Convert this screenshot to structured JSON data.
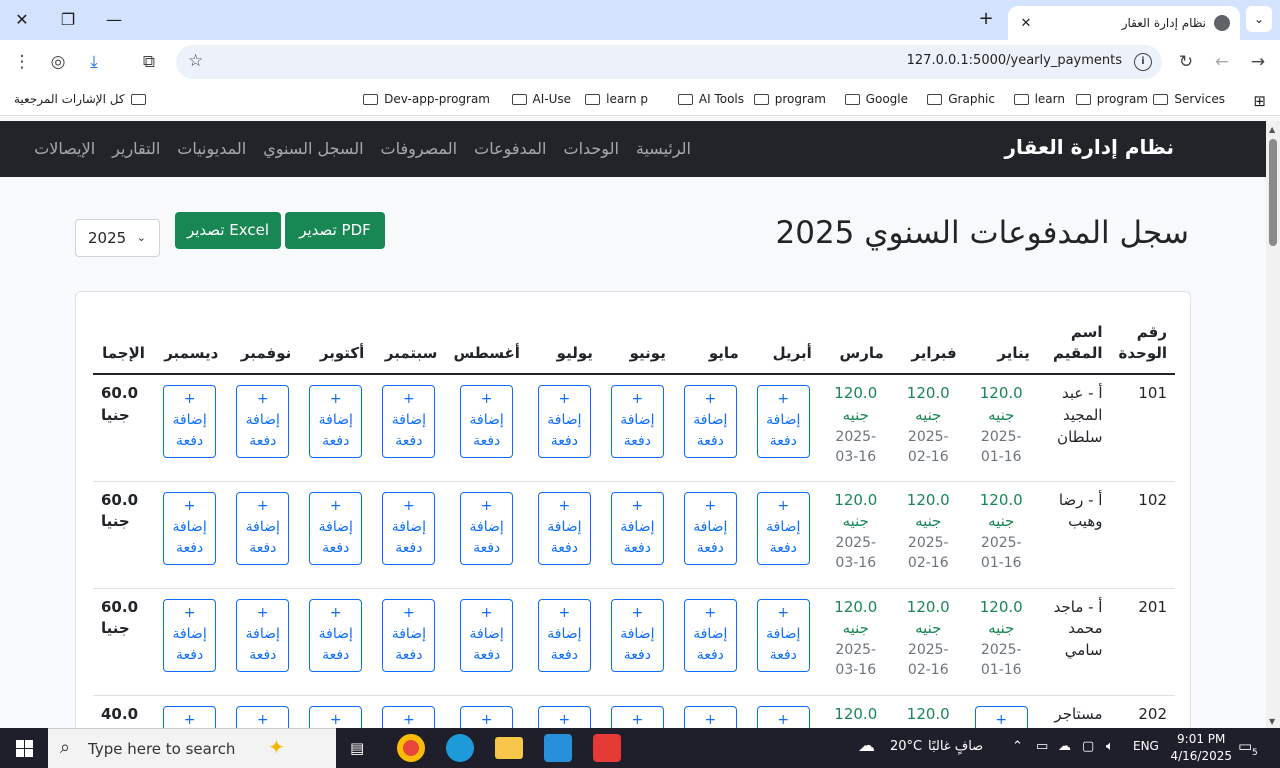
{
  "browser": {
    "tab_title": "نظام إدارة العقار",
    "url": "127.0.0.1:5000/yearly_payments",
    "bookmarks": [
      "Services",
      "program",
      "learn",
      "Graphic",
      "Google",
      "program",
      "AI Tools",
      "learn p",
      "AI-Use",
      "Dev-app-program"
    ],
    "all_bookmarks": "كل الإشارات المرجعية"
  },
  "nav": {
    "brand": "نظام إدارة العقار",
    "links": [
      "الرئيسية",
      "الوحدات",
      "المدفوعات",
      "المصروفات",
      "السجل السنوي",
      "المديونيات",
      "التقارير",
      "الإيصالات"
    ]
  },
  "page": {
    "title": "سجل المدفوعات السنوي 2025",
    "export_pdf": "تصدير PDF",
    "export_excel": "تصدير Excel",
    "year": "2025"
  },
  "table": {
    "headers": [
      "رقم الوحدة",
      "اسم المقيم",
      "يناير",
      "فبراير",
      "مارس",
      "أبريل",
      "مايو",
      "يونيو",
      "يوليو",
      "أغسطس",
      "سبتمبر",
      "أكتوبر",
      "نوفمبر",
      "ديسمبر",
      "الإجما"
    ],
    "add_label_plus": "+",
    "add_label_1": "إضافة",
    "add_label_2": "دفعة",
    "rows": [
      {
        "unit": "101",
        "name": "أ - عبد المجيد سلطان",
        "payments": [
          {
            "amount": "120.0",
            "currency": "جنيه",
            "date": "2025-01-16"
          },
          {
            "amount": "120.0",
            "currency": "جنيه",
            "date": "2025-02-16"
          },
          {
            "amount": "120.0",
            "currency": "جنيه",
            "date": "2025-03-16"
          }
        ],
        "total": "60.0",
        "total_cur": "جنيا"
      },
      {
        "unit": "102",
        "name": "أ - رضا وهيب",
        "payments": [
          {
            "amount": "120.0",
            "currency": "جنيه",
            "date": "2025-01-16"
          },
          {
            "amount": "120.0",
            "currency": "جنيه",
            "date": "2025-02-16"
          },
          {
            "amount": "120.0",
            "currency": "جنيه",
            "date": "2025-03-16"
          }
        ],
        "total": "60.0",
        "total_cur": "جنيا"
      },
      {
        "unit": "201",
        "name": "أ - ماجد محمد سامي",
        "payments": [
          {
            "amount": "120.0",
            "currency": "جنيه",
            "date": "2025-01-16"
          },
          {
            "amount": "120.0",
            "currency": "جنيه",
            "date": "2025-02-16"
          },
          {
            "amount": "120.0",
            "currency": "جنيه",
            "date": "2025-03-16"
          }
        ],
        "total": "60.0",
        "total_cur": "جنيا"
      },
      {
        "unit": "202",
        "name": "مستاجر -",
        "payments": [
          {
            "amount": "",
            "currency": "",
            "date": ""
          },
          {
            "amount": "120.0",
            "currency": "",
            "date": ""
          },
          {
            "amount": "120.0",
            "currency": "",
            "date": ""
          }
        ],
        "total": "40.0",
        "total_cur": ""
      }
    ]
  },
  "taskbar": {
    "search_placeholder": "Type here to search",
    "weather": "20°C",
    "weather_text": "صافٍ غالبًا",
    "lang": "ENG",
    "time": "9:01 PM",
    "date": "4/16/2025",
    "notif_count": "5"
  }
}
